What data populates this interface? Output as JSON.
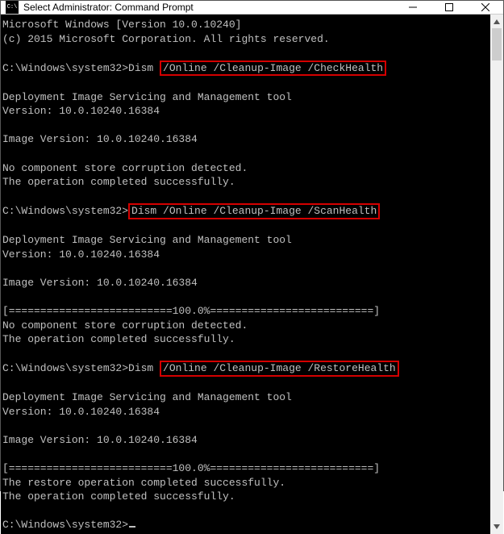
{
  "titlebar": {
    "title": "Select Administrator: Command Prompt"
  },
  "lines": [
    {
      "type": "text",
      "text": "Microsoft Windows [Version 10.0.10240]"
    },
    {
      "type": "text",
      "text": "(c) 2015 Microsoft Corporation. All rights reserved."
    },
    {
      "type": "blank"
    },
    {
      "type": "prompt_cmd",
      "prompt": "C:\\Windows\\system32>",
      "cmd_prefix": "Dism ",
      "highlight": "/Online /Cleanup-Image /CheckHealth"
    },
    {
      "type": "blank"
    },
    {
      "type": "text",
      "text": "Deployment Image Servicing and Management tool"
    },
    {
      "type": "text",
      "text": "Version: 10.0.10240.16384"
    },
    {
      "type": "blank"
    },
    {
      "type": "text",
      "text": "Image Version: 10.0.10240.16384"
    },
    {
      "type": "blank"
    },
    {
      "type": "text",
      "text": "No component store corruption detected."
    },
    {
      "type": "text",
      "text": "The operation completed successfully."
    },
    {
      "type": "blank"
    },
    {
      "type": "prompt_cmd",
      "prompt": "C:\\Windows\\system32>",
      "cmd_prefix": "",
      "highlight": "Dism /Online /Cleanup-Image /ScanHealth"
    },
    {
      "type": "blank"
    },
    {
      "type": "text",
      "text": "Deployment Image Servicing and Management tool"
    },
    {
      "type": "text",
      "text": "Version: 10.0.10240.16384"
    },
    {
      "type": "blank"
    },
    {
      "type": "text",
      "text": "Image Version: 10.0.10240.16384"
    },
    {
      "type": "blank"
    },
    {
      "type": "text",
      "text": "[==========================100.0%==========================]"
    },
    {
      "type": "text",
      "text": "No component store corruption detected."
    },
    {
      "type": "text",
      "text": "The operation completed successfully."
    },
    {
      "type": "blank"
    },
    {
      "type": "prompt_cmd",
      "prompt": "C:\\Windows\\system32>",
      "cmd_prefix": "Dism ",
      "highlight": "/Online /Cleanup-Image /RestoreHealth"
    },
    {
      "type": "blank"
    },
    {
      "type": "text",
      "text": "Deployment Image Servicing and Management tool"
    },
    {
      "type": "text",
      "text": "Version: 10.0.10240.16384"
    },
    {
      "type": "blank"
    },
    {
      "type": "text",
      "text": "Image Version: 10.0.10240.16384"
    },
    {
      "type": "blank"
    },
    {
      "type": "text",
      "text": "[==========================100.0%==========================]"
    },
    {
      "type": "text",
      "text": "The restore operation completed successfully."
    },
    {
      "type": "text",
      "text": "The operation completed successfully."
    },
    {
      "type": "blank"
    },
    {
      "type": "prompt_cursor",
      "prompt": "C:\\Windows\\system32>"
    }
  ]
}
